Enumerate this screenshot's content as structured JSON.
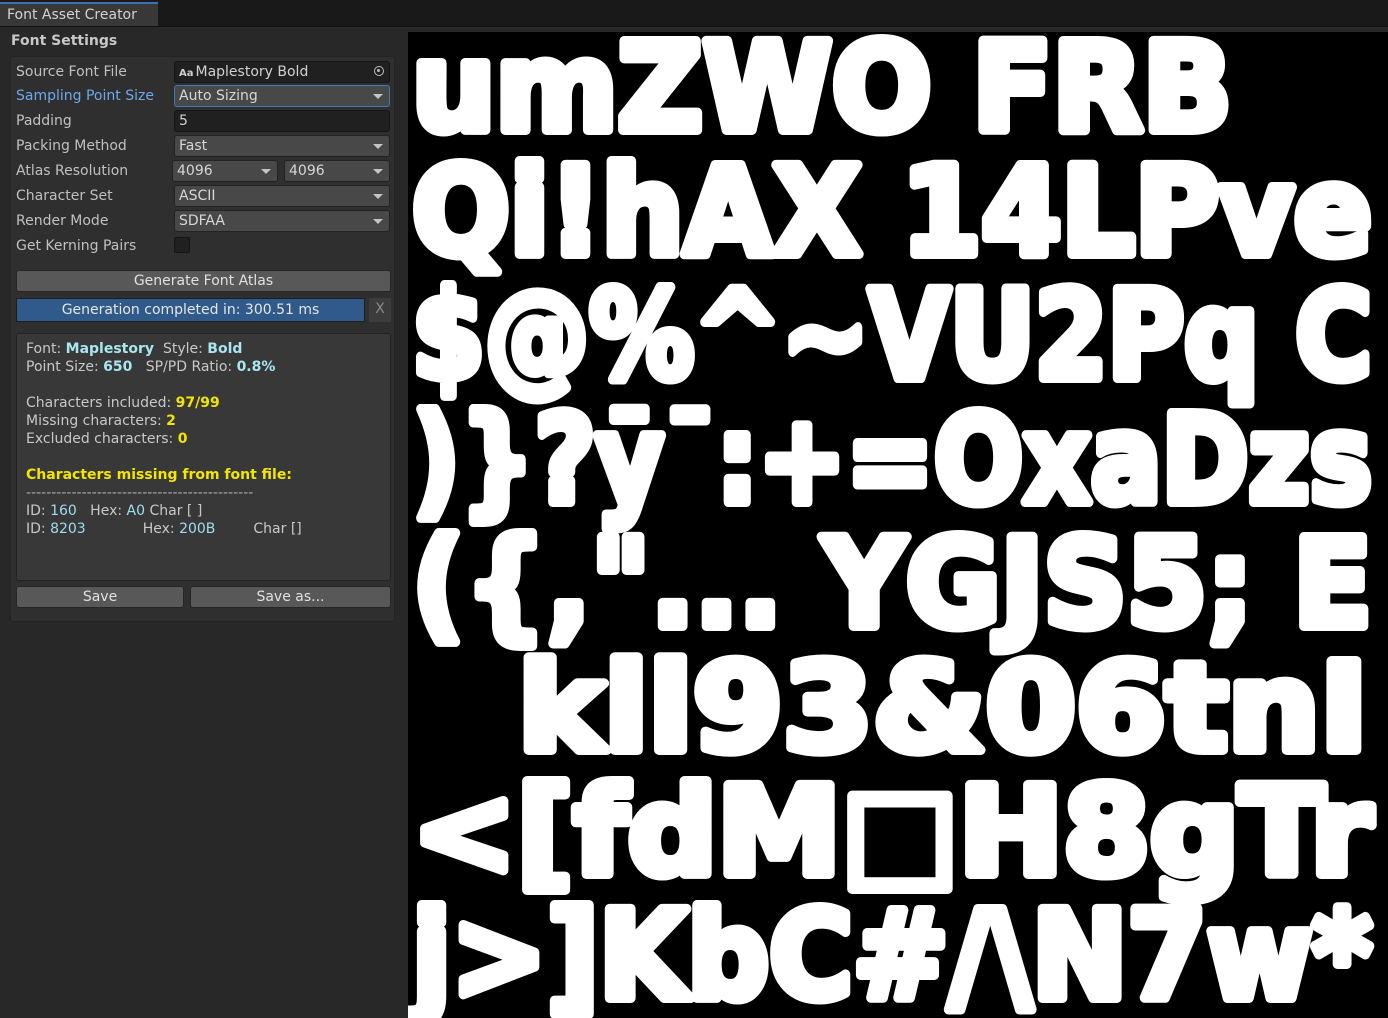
{
  "window": {
    "tab_title": "Font Asset Creator"
  },
  "settings": {
    "section_title": "Font Settings",
    "source_font": {
      "label": "Source Font File",
      "value": "Maplestory Bold",
      "icon": "font-asset-icon"
    },
    "sampling": {
      "label": "Sampling Point Size",
      "value": "Auto Sizing"
    },
    "padding": {
      "label": "Padding",
      "value": "5"
    },
    "packing": {
      "label": "Packing Method",
      "value": "Fast"
    },
    "atlas_resolution": {
      "label": "Atlas Resolution",
      "width": "4096",
      "height": "4096"
    },
    "character_set": {
      "label": "Character Set",
      "value": "ASCII"
    },
    "render_mode": {
      "label": "Render Mode",
      "value": "SDFAA"
    },
    "kerning": {
      "label": "Get Kerning Pairs",
      "checked": false
    }
  },
  "actions": {
    "generate_label": "Generate Font Atlas",
    "progress_text": "Generation completed in: 300.51 ms",
    "progress_fraction": 1.0,
    "close_label": "X",
    "save_label": "Save",
    "save_as_label": "Save as..."
  },
  "info": {
    "font_label": "Font: ",
    "font_value": "Maplestory",
    "style_label": "Style: ",
    "style_value": "Bold",
    "point_size_label": "Point Size: ",
    "point_size_value": "650",
    "ratio_label": "SP/PD Ratio: ",
    "ratio_value": "0.8%",
    "included_label": "Characters included: ",
    "included_value": "97/99",
    "missing_label": "Missing characters: ",
    "missing_value": "2",
    "excluded_label": "Excluded characters: ",
    "excluded_value": "0",
    "missing_header": "Characters missing from font file:",
    "separator": "---------------------------------------------",
    "missing_list": [
      {
        "id_label": "ID: ",
        "id": "160",
        "hex_label": "Hex: ",
        "hex": "A0",
        "char_label": "Char [ ]"
      },
      {
        "id_label": "ID: ",
        "id": "8203",
        "hex_label": "Hex: ",
        "hex": "200B",
        "char_label": "Char []"
      }
    ]
  },
  "atlas": {
    "rows": [
      "umZWO FRB",
      "Qi!hAX 14LPve",
      "$@%^~VU2Pq C",
      ")}?ȳ¯:+=OxaDzs",
      "({,\"... YGJS5; E",
      "kll93&06tnI",
      "<[fdM□H8gTr",
      "j>]KbC#/\\N7w*"
    ]
  }
}
